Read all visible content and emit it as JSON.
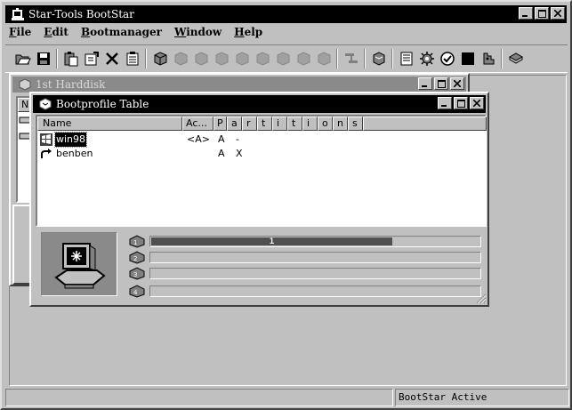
{
  "app": {
    "title": "Star-Tools BootStar"
  },
  "menu": [
    {
      "key": "F",
      "rest": "ile"
    },
    {
      "key": "E",
      "rest": "dit"
    },
    {
      "key": "B",
      "rest": "ootmanager"
    },
    {
      "key": "W",
      "rest": "indow"
    },
    {
      "key": "H",
      "rest": "elp"
    }
  ],
  "toolbar_icons": [
    "open-folder-icon",
    "save-disk-icon",
    "paste-icon",
    "properties-icon",
    "delete-x-icon",
    "new-document-icon",
    "harddisk-icon",
    "harddisk-icon",
    "harddisk-icon",
    "harddisk-icon",
    "harddisk-icon",
    "harddisk-icon",
    "harddisk-icon",
    "harddisk-icon",
    "harddisk-icon",
    "copy-partition-icon",
    "disk-stack-icon",
    "report-icon",
    "settings-gear-icon",
    "check-icon",
    "moon-icon",
    "puzzle-icon",
    "help-book-icon"
  ],
  "harddisk_window": {
    "title": "1st Harddisk",
    "col_first": "N"
  },
  "bootprofile_window": {
    "title": "Bootprofile Table",
    "columns": {
      "name": "Name",
      "active": "Ac...",
      "p": "P",
      "partitions": [
        "a",
        "r",
        "t",
        "i",
        "t",
        "i",
        "o",
        "n",
        "s"
      ]
    },
    "rows": [
      {
        "name": "win98",
        "active": "<A>",
        "p": "A",
        "part1": "-",
        "selected": true,
        "icon": "windows-os-icon"
      },
      {
        "name": "benben",
        "active": "",
        "p": "A",
        "part1": "X",
        "selected": false,
        "icon": "redirect-arrow-icon"
      }
    ],
    "partition_bars": [
      {
        "label": "1",
        "fill_percent": 73
      },
      {
        "label": "",
        "fill_percent": 0
      },
      {
        "label": "",
        "fill_percent": 0
      },
      {
        "label": "",
        "fill_percent": 0
      }
    ]
  },
  "status": {
    "left": "",
    "right": "BootStar Active"
  },
  "colors": {
    "title_active": "#000000",
    "title_inactive": "#8a8a8a",
    "face": "#c0c0c0",
    "bar_fill": "#505050"
  }
}
